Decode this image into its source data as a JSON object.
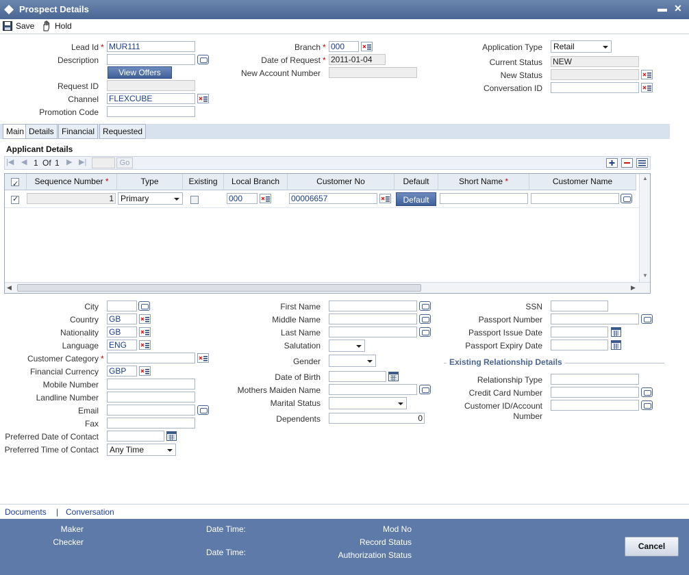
{
  "window": {
    "title": "Prospect Details",
    "minimize": "▬",
    "close": "✕"
  },
  "toolbar": {
    "save_label": "Save",
    "hold_label": "Hold"
  },
  "header": {
    "lead_id_label": "Lead Id",
    "lead_id_value": "MUR111",
    "description_label": "Description",
    "description_value": "",
    "view_offers_label": "View Offers",
    "request_id_label": "Request ID",
    "request_id_value": "",
    "channel_label": "Channel",
    "channel_value": "FLEXCUBE",
    "promotion_code_label": "Promotion Code",
    "promotion_code_value": "",
    "branch_label": "Branch",
    "branch_value": "000",
    "date_of_request_label": "Date of Request",
    "date_of_request_value": "2011-01-04",
    "new_account_number_label": "New Account Number",
    "new_account_number_value": "",
    "application_type_label": "Application Type",
    "application_type_value": "Retail",
    "current_status_label": "Current Status",
    "current_status_value": "NEW",
    "new_status_label": "New Status",
    "new_status_value": "",
    "conversation_id_label": "Conversation ID",
    "conversation_id_value": ""
  },
  "tabs": [
    "Main",
    "Details",
    "Financial",
    "Requested"
  ],
  "applicant": {
    "section_title": "Applicant Details",
    "pager": {
      "page": "1",
      "of_label": "Of",
      "total": "1",
      "go_label": "Go"
    },
    "columns": [
      "Sequence Number",
      "Type",
      "Existing",
      "Local Branch",
      "Customer No",
      "Default",
      "Short Name",
      "Customer Name"
    ],
    "row": {
      "sequence": "1",
      "type": "Primary",
      "local_branch": "000",
      "customer_no": "00006657",
      "default_label": "Default",
      "short_name": "",
      "customer_name": ""
    }
  },
  "details_left": {
    "city_label": "City",
    "city_value": "",
    "country_label": "Country",
    "country_value": "GB",
    "nationality_label": "Nationality",
    "nationality_value": "GB",
    "language_label": "Language",
    "language_value": "ENG",
    "customer_category_label": "Customer Category",
    "customer_category_value": "",
    "financial_currency_label": "Financial Currency",
    "financial_currency_value": "GBP",
    "mobile_label": "Mobile Number",
    "mobile_value": "",
    "landline_label": "Landline Number",
    "landline_value": "",
    "email_label": "Email",
    "email_value": "",
    "fax_label": "Fax",
    "fax_value": "",
    "pref_date_label": "Preferred Date of Contact",
    "pref_date_value": "",
    "pref_time_label": "Preferred Time of Contact",
    "pref_time_value": "Any Time"
  },
  "details_mid": {
    "first_name_label": "First Name",
    "middle_name_label": "Middle Name",
    "last_name_label": "Last Name",
    "salutation_label": "Salutation",
    "gender_label": "Gender",
    "dob_label": "Date of Birth",
    "maiden_label": "Mothers Maiden Name",
    "marital_label": "Marital Status",
    "dependents_label": "Dependents",
    "dependents_value": "0"
  },
  "details_right": {
    "ssn_label": "SSN",
    "passport_label": "Passport Number",
    "passport_issue_label": "Passport Issue Date",
    "passport_expiry_label": "Passport Expiry Date",
    "existing_rel_title": "Existing Relationship Details",
    "rel_type_label": "Relationship Type",
    "credit_card_label": "Credit Card Number",
    "customer_id_label": "Customer ID/Account",
    "customer_id_label2": "Number"
  },
  "links": {
    "documents": "Documents",
    "separator": "|",
    "conversation": "Conversation"
  },
  "footer": {
    "maker_label": "Maker",
    "checker_label": "Checker",
    "datetime_label": "Date Time:",
    "datetime_label2": "Date Time:",
    "mod_no_label": "Mod No",
    "record_status_label": "Record Status",
    "auth_status_label": "Authorization Status",
    "cancel_label": "Cancel"
  },
  "colors": {
    "titlebar": "#5a76a3",
    "footer": "#5e7aa8",
    "required": "#cc0000",
    "link": "#1a3da0"
  }
}
